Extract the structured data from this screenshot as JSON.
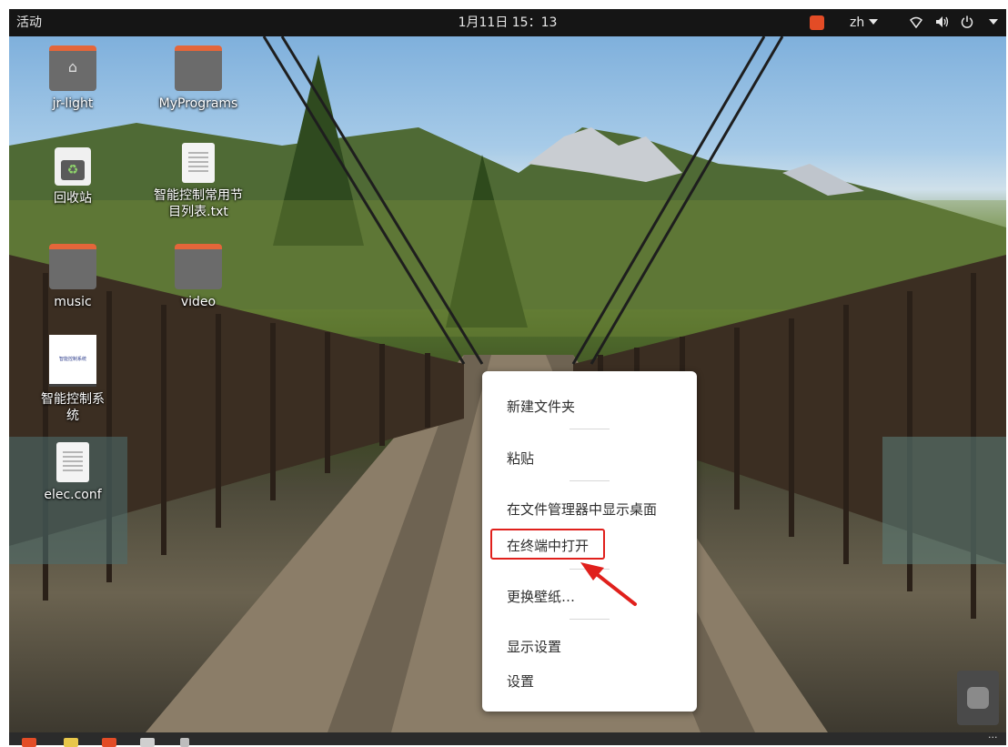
{
  "topbar": {
    "activities": "活动",
    "clock": "1月11日 15：13",
    "language": "zh"
  },
  "desktop": {
    "icons": [
      {
        "label": "jr-light",
        "kind": "home-folder"
      },
      {
        "label": "MyPrograms",
        "kind": "folder"
      },
      {
        "label": "回收站",
        "kind": "trash"
      },
      {
        "label": "智能控制常用节目列表.txt",
        "kind": "text-file"
      },
      {
        "label": "music",
        "kind": "folder"
      },
      {
        "label": "video",
        "kind": "folder"
      },
      {
        "label": "智能控制系统",
        "kind": "app-image",
        "thumb_text": "智能控制系统"
      },
      {
        "label": "elec.conf",
        "kind": "text-file"
      }
    ]
  },
  "context_menu": {
    "items": [
      {
        "label": "新建文件夹"
      },
      {
        "label": "粘贴"
      },
      {
        "label": "在文件管理器中显示桌面"
      },
      {
        "label": "在终端中打开",
        "highlighted": true
      },
      {
        "label": "更换壁纸…"
      },
      {
        "label": "显示设置"
      },
      {
        "label": "设置"
      }
    ]
  },
  "colors": {
    "topbar_bg": "#151515",
    "highlight_red": "#e0201c",
    "folder_accent": "#e4663a"
  },
  "icons": {
    "network": "network-wifi-icon",
    "volume": "speaker-icon",
    "power": "power-icon"
  }
}
